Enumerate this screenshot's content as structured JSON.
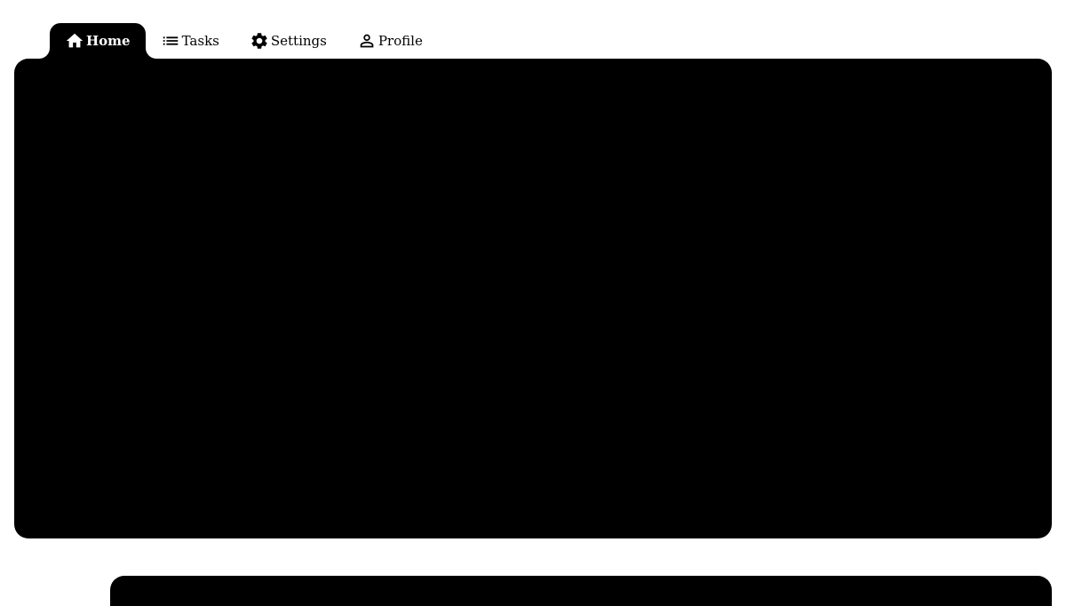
{
  "tabs": [
    {
      "id": "home",
      "label": "Home",
      "icon": "home-icon",
      "active": true
    },
    {
      "id": "tasks",
      "label": "Tasks",
      "icon": "list-icon",
      "active": false
    },
    {
      "id": "settings",
      "label": "Settings",
      "icon": "gear-icon",
      "active": false
    },
    {
      "id": "profile",
      "label": "Profile",
      "icon": "person-icon",
      "active": false
    }
  ],
  "colors": {
    "panel": "#000000",
    "active_tab_bg": "#000000",
    "active_tab_text": "#ffffff",
    "page_bg": "#ffffff"
  }
}
